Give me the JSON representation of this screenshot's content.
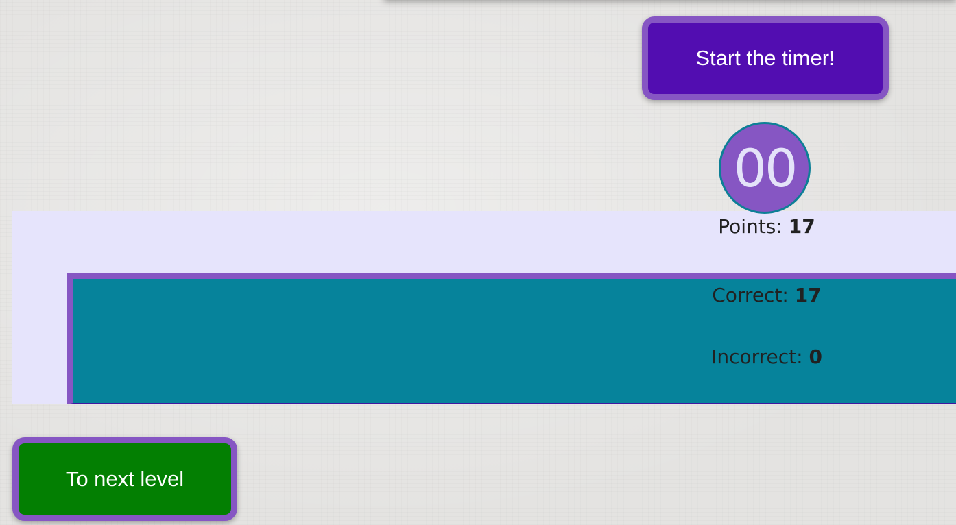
{
  "buttons": {
    "start_timer_label": "Start the timer!",
    "next_level_label": "To next level"
  },
  "timer": {
    "display": "00"
  },
  "stats": {
    "points_label": "Points:",
    "points_value": "17",
    "correct_label": "Correct:",
    "correct_value": "17",
    "incorrect_label": "Incorrect:",
    "incorrect_value": "0"
  },
  "colors": {
    "timer_button_bg": "#520db1",
    "button_border": "#8656c3",
    "next_button_bg": "#037f02",
    "panel_outer_bg": "#e6e4fc",
    "panel_inner_bg": "#06839b",
    "timer_circle_bg": "#8656c3"
  }
}
